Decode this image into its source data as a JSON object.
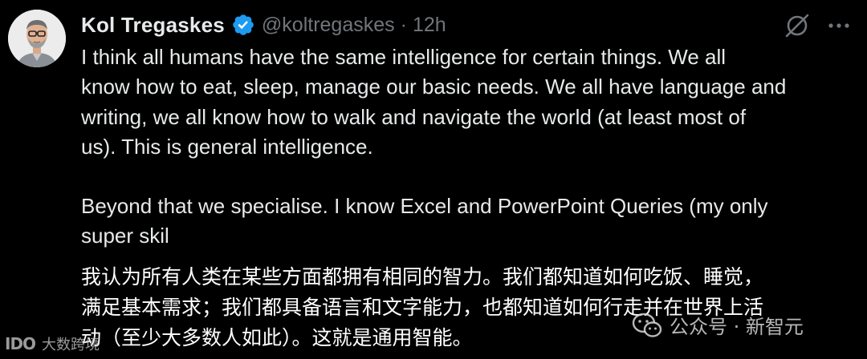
{
  "tweet": {
    "author": {
      "display_name": "Kol Tregaskes",
      "handle": "@koltregaskes",
      "verified": true
    },
    "separator": "·",
    "time": "12h",
    "paragraphs": [
      "I think all humans have the same intelligence for certain things.  We all\nknow how to eat, sleep, manage our basic needs.  We all have language and\nwriting, we all know how to walk and navigate the world (at least most of\nus).  This is general intelligence.",
      "Beyond that we specialise.  I know Excel and PowerPoint Queries (my only\nsuper skil"
    ],
    "icons": {
      "verified": "verified-badge-icon",
      "grok": "grok-icon",
      "more": "more-icon"
    }
  },
  "translation": "我认为所有人类在某些方面都拥有相同的智力。我们都知道如何吃饭、睡觉，\n满足基本需求；我们都具备语言和文字能力，也都知道如何行走并在世界上活\n动（至少大多数人如此）。这就是通用智能。",
  "watermarks": {
    "left_logo": "IDO",
    "left_text": "大数跨境",
    "right_text": "公众号 · 新智元"
  },
  "colors": {
    "background": "#000000",
    "primary_text": "#e7e9ea",
    "secondary_text": "#71767b",
    "verified_blue": "#1d9bf0"
  }
}
